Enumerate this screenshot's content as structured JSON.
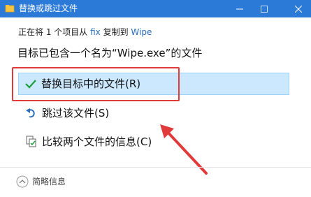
{
  "window": {
    "title": "替换或跳过文件",
    "min_symbol": "—",
    "max_symbol": "☐",
    "close_symbol": "✕"
  },
  "progress": {
    "prefix": "正在将 1 个项目从 ",
    "source": "fix",
    "middle": " 复制到 ",
    "destination": "Wipe"
  },
  "heading": "目标已包含一个名为“Wipe.exe”的文件",
  "options": {
    "replace_label": "替换目标中的文件(R)",
    "skip_label": "跳过该文件(S)",
    "compare_label": "比较两个文件的信息(C)"
  },
  "footer": {
    "details_label": "简略信息"
  },
  "colors": {
    "titlebar": "#2b7ad8",
    "link": "#2a6db9",
    "selected_bg": "#cce8ff",
    "annotation_red": "#e03a3a",
    "check_green": "#1e9e3a"
  },
  "icons": {
    "replace": "checkmark-icon",
    "skip": "skip-arrow-icon",
    "compare": "compare-files-icon",
    "details": "chevron-up-icon"
  }
}
